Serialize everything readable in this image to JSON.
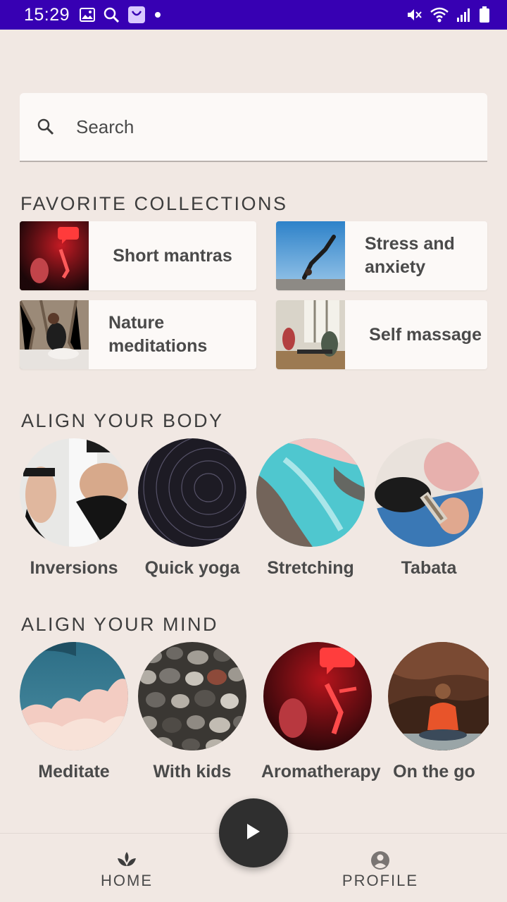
{
  "status_bar": {
    "time": "15:29",
    "left_icons": [
      "image-icon",
      "search-icon",
      "shop-icon",
      "dot-icon"
    ],
    "right_icons": [
      "mute-icon",
      "wifi-icon",
      "signal-icon",
      "battery-icon"
    ],
    "background": "#3700b3"
  },
  "search": {
    "placeholder": "Search",
    "value": ""
  },
  "favorite_collections": {
    "title": "FAVORITE COLLECTIONS",
    "items": [
      {
        "label": "Short mantras"
      },
      {
        "label": "Stress and anxiety"
      },
      {
        "label": "Nature meditations"
      },
      {
        "label": "Self massage"
      }
    ]
  },
  "align_body": {
    "title": "ALIGN YOUR BODY",
    "items": [
      {
        "label": "Inversions"
      },
      {
        "label": "Quick yoga"
      },
      {
        "label": "Stretching"
      },
      {
        "label": "Tabata"
      }
    ]
  },
  "align_mind": {
    "title": "ALIGN YOUR MIND",
    "items": [
      {
        "label": "Meditate"
      },
      {
        "label": "With kids"
      },
      {
        "label": "Aromatherapy"
      },
      {
        "label": "On the go"
      }
    ]
  },
  "bottom_nav": {
    "home_label": "HOME",
    "profile_label": "PROFILE",
    "play_icon": "play-icon"
  },
  "colors": {
    "background": "#f1e8e3",
    "surface": "#fcf9f7",
    "text": "#3d3d3d",
    "fab": "#2f2f2f"
  }
}
